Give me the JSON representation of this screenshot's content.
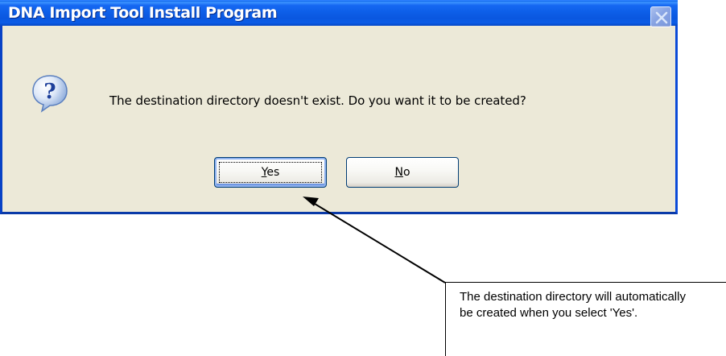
{
  "dialog": {
    "title": "DNA Import Tool Install Program",
    "close_icon": "close-x-icon",
    "message_icon": "question-mark-icon",
    "message": "The destination directory doesn't exist. Do you want it to be created?",
    "buttons": {
      "yes": {
        "mnemonic": "Y",
        "rest": "es"
      },
      "no": {
        "mnemonic": "N",
        "rest": "o"
      }
    }
  },
  "annotation": {
    "text": "The destination directory will automatically be created when you select 'Yes'.",
    "arrow_icon": "arrow-icon"
  },
  "colors": {
    "titlebar": "#0a57e0",
    "dialog_face": "#ece9d8",
    "button_border": "#003c74"
  }
}
